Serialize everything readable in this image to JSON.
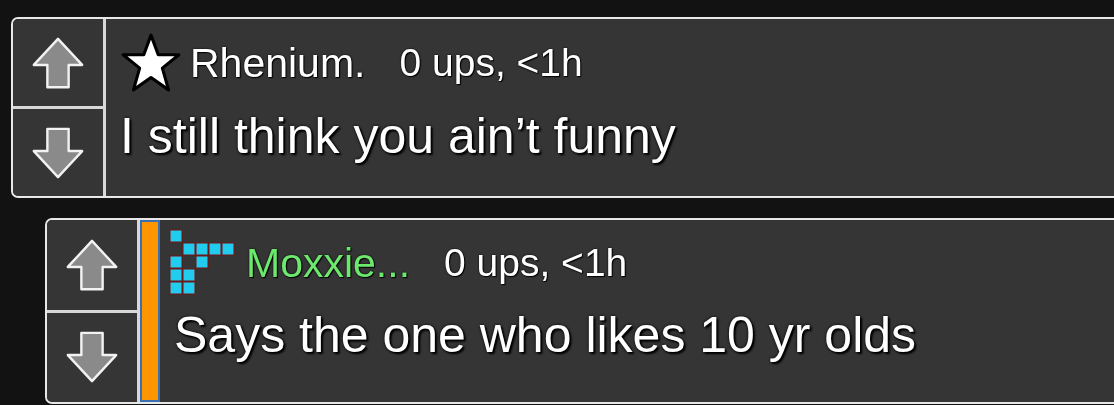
{
  "comments": [
    {
      "kind": "top",
      "avatar": {
        "kind": "star"
      },
      "author": "Rhenium.",
      "color": "#ffffff",
      "meta": "0 ups, <1h",
      "text": "I still think you ain’t funny"
    },
    {
      "kind": "reply",
      "avatar": {
        "kind": "blocks"
      },
      "author": "Moxxie...",
      "color": "#6ce96c",
      "meta": "0 ups, <1h",
      "text": "Says the one who likes 10 yr olds"
    }
  ]
}
